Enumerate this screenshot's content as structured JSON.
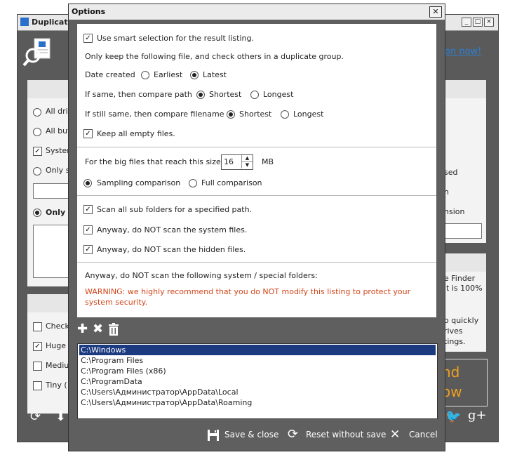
{
  "background_window": {
    "title": "Duplicate",
    "link_text": "on now!",
    "sidebar_options": [
      "All dri",
      "All but",
      "Syster",
      "Only s",
      "Only s"
    ],
    "filter_options": [
      "Check",
      "Huge",
      "Mediu",
      "Tiny ("
    ],
    "right_texts": [
      "sed",
      "n",
      "nsion"
    ],
    "right_block_lines": [
      "e Finder",
      "lt is 100%",
      "o quickly",
      "rives",
      "tings."
    ],
    "promo_lines": [
      "nd",
      "ow"
    ]
  },
  "dialog": {
    "title": "Options",
    "smart_selection_label": "Use smart selection for the result listing.",
    "keep_file_text": "Only keep the following file, and check others in a duplicate group.",
    "date_created": {
      "label": "Date created",
      "options": [
        "Earliest",
        "Latest"
      ],
      "selected": "Latest"
    },
    "compare_path": {
      "label": "If same, then compare path",
      "options": [
        "Shortest",
        "Longest"
      ],
      "selected": "Shortest"
    },
    "compare_filename": {
      "label": "If still same, then compare filename",
      "options": [
        "Shortest",
        "Longest"
      ],
      "selected": "Shortest"
    },
    "keep_empty_label": "Keep all empty files.",
    "big_files_label": "For the big files that reach this size",
    "big_files_size": "16",
    "big_files_unit": "MB",
    "comparison_options": [
      "Sampling comparison",
      "Full comparison"
    ],
    "comparison_selected": "Sampling comparison",
    "scan_sub_label": "Scan all sub folders for a specified path.",
    "no_system_label": "Anyway, do NOT scan the system files.",
    "no_hidden_label": "Anyway, do NOT scan the hidden files.",
    "folders_text": "Anyway, do NOT scan the following system / special folders:",
    "warning_line1": "WARNING: we highly recommend that you do NOT modify this listing to protect your",
    "warning_line2": "system security.",
    "folders": [
      "C:\\Windows",
      "C:\\Program Files",
      "C:\\Program Files (x86)",
      "C:\\ProgramData",
      "C:\\Users\\Администратор\\AppData\\Local",
      "C:\\Users\\Администратор\\AppData\\Roaming"
    ],
    "save_close": "Save & close",
    "reset": "Reset without save",
    "cancel": "Cancel"
  },
  "colors": {
    "warning": "#d2451a",
    "selection": "#1c3a80",
    "frame": "#5f5f5f",
    "promo": "#f0a020"
  }
}
